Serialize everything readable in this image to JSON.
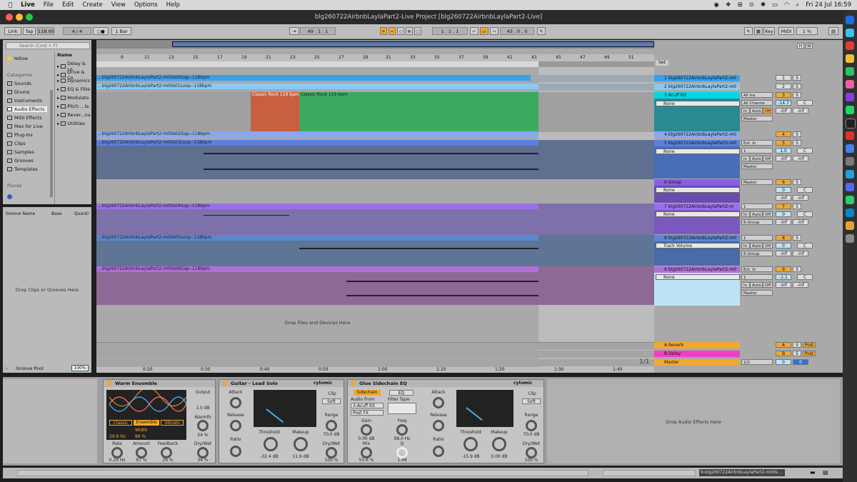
{
  "menubar": {
    "app": "Live",
    "items": [
      "File",
      "Edit",
      "Create",
      "View",
      "Options",
      "Help"
    ],
    "clock": "Fri 24 Jul  16:59"
  },
  "window": {
    "title": "blg260722AirbnbLaylaPart2-Live Project  [blg260722AirbnbLaylaPart2-Live]"
  },
  "controlbar": {
    "link": "Link",
    "tap": "Tap",
    "tempo": "118.00",
    "signature": "4  /  4",
    "metro": "○●",
    "quant": "1 Bar",
    "position": "49 .  1 .  1",
    "loop_start": "1 .  1 .  1",
    "loop_len": "43 .  0 .  0",
    "key": "Key",
    "midi": "MIDI",
    "cpu": "1 %"
  },
  "browser": {
    "search_placeholder": "Search (Cmd + F)",
    "collection_yellow": "Yellow",
    "categories_label": "Categories",
    "categories": [
      "Sounds",
      "Drums",
      "Instruments",
      "Audio Effects",
      "MIDI Effects",
      "Max for Live",
      "Plug-Ins",
      "Clips",
      "Samples",
      "Grooves",
      "Templates"
    ],
    "places_label": "Places",
    "name_header": "Name",
    "folders": [
      "Delay & Lo",
      "Drive & Co",
      "Dynamics",
      "EQ & Filte",
      "Modulato",
      "Pitch ...la",
      "Rever...na",
      "Utilities"
    ]
  },
  "groove": {
    "name_header": "Groove Name",
    "base_header": "Base",
    "quant_header": "Quanti",
    "drop_hint": "Drop Clips or Grooves Here",
    "pool_label": "Groove Pool",
    "pool_value": "100%"
  },
  "arrangement": {
    "bar_numbers": [
      "9",
      "11",
      "13",
      "15",
      "17",
      "19",
      "21",
      "23",
      "25",
      "27",
      "29",
      "31",
      "33",
      "35",
      "37",
      "39",
      "41",
      "43",
      "45",
      "47",
      "49",
      "51"
    ],
    "clips": {
      "c1": "...blg260722AirbnbLaylaPart2-m00s00Gap--118bpm",
      "c2": "...blg260722AirbnbLaylaPart2-m00s01Loop--118bpm",
      "c3a": "Classic Rock 119 bpm",
      "c3b": "Classic Rock 119 bpm",
      "c4": "...blg260722AirbnbLaylaPart2-m00s02Gap--118bpm",
      "c5": "...blg260722AirbnbLaylaPart2-m00s03Loop--118bpm",
      "c7": "...blg260722AirbnbLaylaPart2-m00s04Gap--118bpm",
      "c8": "...blg260722AirbnbLaylaPart2-m00s05Loop--118bpm",
      "c9": "...blg260722AirbnbLaylaPart2-m00s06Gap--118bpm"
    },
    "drop_hint": "Drop Files and Devices Here",
    "time_labels": [
      "0:20",
      "0:30",
      "0:40",
      "0:50",
      "1:00",
      "1:10",
      "1:20",
      "1:30",
      "1:40"
    ],
    "zoom": "1/1",
    "set_label": "Set"
  },
  "tracks": [
    {
      "name": "1 blg260722AirbnbLaylaPart2-m0",
      "num": "1",
      "color": "#3aa0e8"
    },
    {
      "name": "2 blg260722AirbnbLaylaPart2-m0",
      "num": "2",
      "color": "#8cc8f0"
    },
    {
      "name": "3 Acuff Kit",
      "num": "3",
      "color": "#00d8e8"
    },
    {
      "name": "4 blg260722AirbnbLaylaPart2-m0",
      "num": "4",
      "color": "#8aa8f0"
    },
    {
      "name": "5 blg260722AirbnbLaylaPart2-m0",
      "num": "5",
      "color": "#5a80e0"
    },
    {
      "name": "6 Group",
      "num": "6",
      "color": "#8860e0"
    },
    {
      "name": "7 blg260722AirbnbLaylaPart2-m",
      "num": "7",
      "color": "#9a70e8"
    },
    {
      "name": "8 blg260722AirbnbLaylaPart2-m0",
      "num": "8",
      "color": "#5a88d0"
    },
    {
      "name": "9 blg260722AirbnbLaylaPart2-m0",
      "num": "9",
      "color": "#b070d8"
    }
  ],
  "mixer": {
    "none": "None",
    "track_volume": "Track Volume",
    "all_ins": "All Ins",
    "all_channels": "All Channe",
    "ext_in": "Ext. In",
    "one": "1",
    "in": "In",
    "auto": "Auto",
    "off": "Off",
    "master": "Master",
    "group6": "6-Group",
    "inf": "-inf",
    "vol3": "-14.7",
    "vol5": "1.0",
    "vol6": "0",
    "vol7": "0",
    "vol8": "0",
    "vol9": "-1.1",
    "c": "C",
    "s": "S",
    "return_a": "A Reverb",
    "return_b": "B Delay",
    "master_track": "Master",
    "ret_a_num": "A",
    "ret_b_num": "B",
    "master_num": "0",
    "post": "Post",
    "half": "1/2"
  },
  "devices": {
    "warm": {
      "title": "Warm Ensemble",
      "modes": [
        "Classic",
        "Ensemble",
        "Vibrato"
      ],
      "freq": "29.8 Hz",
      "width_label": "Width",
      "width": "86 %",
      "output_label": "Output",
      "output": "1.0 dB",
      "warmth_label": "Warmth",
      "warmth": "24 %",
      "rate_label": "Rate",
      "rate": "0.29 Hz",
      "amount_label": "Amount",
      "amount": "97 %",
      "feedback_label": "Feedback",
      "feedback": "26 %",
      "drywet_label": "Dry/Wet",
      "drywet": "34 %"
    },
    "guitar": {
      "title": "Guitar - Lead Solo",
      "brand": "cytomic",
      "attack_label": "Attack",
      "release_label": "Release",
      "ratio_label": "Ratio",
      "threshold_label": "Threshold",
      "threshold": "-32.4 dB",
      "makeup_label": "Makeup",
      "makeup": "11.9 dB",
      "clip_label": "Clip",
      "soft": "Soft",
      "range_label": "Range",
      "range": "70.0 dB",
      "drywet_label": "Dry/Wet",
      "drywet": "100 %"
    },
    "glue": {
      "title": "Glue Sidechain EQ",
      "brand": "cytomic",
      "sidechain": "Sidechain",
      "eq": "EQ",
      "audio_from": "Audio From",
      "source": "3-Acuff Kit",
      "post_fx": "Post FX",
      "filter_type": "Filter Type",
      "gain_label": "Gain",
      "gain": "0.00 dB",
      "mix_label": "Mix",
      "mix": "55.6 %",
      "freq_label": "Freq",
      "freq": "98.0 Hz",
      "q_label": "Q",
      "q": "1.48",
      "attack_label": "Attack",
      "release_label": "Release",
      "ratio_label": "Ratio",
      "threshold_label": "Threshold",
      "threshold": "-15.9 dB",
      "makeup_label": "Makeup",
      "makeup": "0.00 dB",
      "clip_label": "Clip",
      "soft": "Soft",
      "range_label": "Range",
      "range": "70.0 dB",
      "drywet_label": "Dry/Wet",
      "drywet": "100 %"
    },
    "drop_hint": "Drop Audio Effects Here"
  },
  "statusbar": {
    "selected": "9-blg260722AirbnbLaylaPart2-m00s..."
  }
}
